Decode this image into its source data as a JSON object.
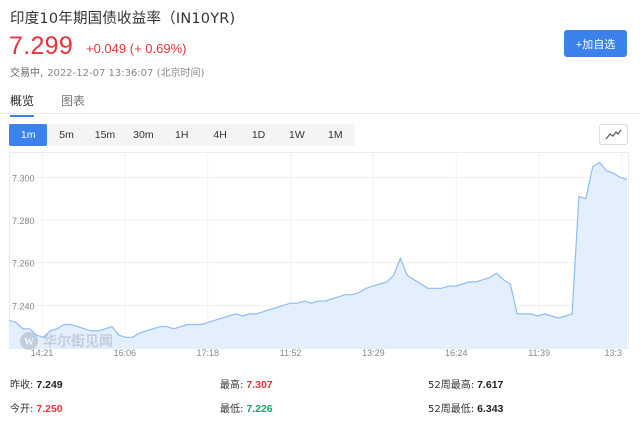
{
  "header": {
    "title": "印度10年期国债收益率（IN10YR)",
    "price": "7.299",
    "change": "+0.049 (+ 0.69%)",
    "status": "交易中,",
    "timestamp": "2022-12-07 13:36:07 (北京时间)",
    "add_button": "+加自选"
  },
  "tabs": [
    {
      "label": "概览",
      "active": true
    },
    {
      "label": "图表",
      "active": false
    }
  ],
  "ranges": [
    "1m",
    "5m",
    "15m",
    "30m",
    "1H",
    "4H",
    "1D",
    "1W",
    "1M"
  ],
  "active_range": "1m",
  "chart_type_icon": "line-chart-icon",
  "watermark": "华尔街见闻",
  "colors": {
    "up": "#e5343a",
    "down": "#22a06b",
    "accent": "#3b82ec",
    "line": "#8fbdf0",
    "fill": "#e3effc"
  },
  "chart_data": {
    "type": "area",
    "x_ticks": [
      "14:21",
      "16:06",
      "17:18",
      "11:52",
      "13:29",
      "16:24",
      "11:39",
      "13:3"
    ],
    "y_ticks": [
      "7.300",
      "7.280",
      "7.260",
      "7.240"
    ],
    "ylim": [
      7.22,
      7.31
    ],
    "grid": true,
    "values": [
      7.233,
      7.232,
      7.229,
      7.229,
      7.226,
      7.225,
      7.228,
      7.229,
      7.231,
      7.231,
      7.23,
      7.229,
      7.228,
      7.228,
      7.229,
      7.23,
      7.226,
      7.225,
      7.225,
      7.227,
      7.228,
      7.229,
      7.23,
      7.23,
      7.229,
      7.23,
      7.231,
      7.231,
      7.231,
      7.232,
      7.233,
      7.234,
      7.235,
      7.236,
      7.235,
      7.236,
      7.236,
      7.237,
      7.238,
      7.239,
      7.24,
      7.241,
      7.241,
      7.242,
      7.241,
      7.242,
      7.242,
      7.243,
      7.244,
      7.245,
      7.245,
      7.246,
      7.248,
      7.249,
      7.25,
      7.251,
      7.254,
      7.262,
      7.254,
      7.252,
      7.25,
      7.248,
      7.248,
      7.248,
      7.249,
      7.249,
      7.25,
      7.251,
      7.251,
      7.252,
      7.253,
      7.255,
      7.252,
      7.25,
      7.236,
      7.236,
      7.236,
      7.235,
      7.236,
      7.235,
      7.234,
      7.235,
      7.236,
      7.291,
      7.29,
      7.305,
      7.307,
      7.303,
      7.302,
      7.3,
      7.299
    ]
  },
  "stats": {
    "prev_close_label": "昨收:",
    "prev_close": "7.249",
    "high_label": "最高:",
    "high": "7.307",
    "week52_high_label": "52周最高:",
    "week52_high": "7.617",
    "open_label": "今开:",
    "open": "7.250",
    "low_label": "最低:",
    "low": "7.226",
    "week52_low_label": "52周最低:",
    "week52_low": "6.343"
  }
}
